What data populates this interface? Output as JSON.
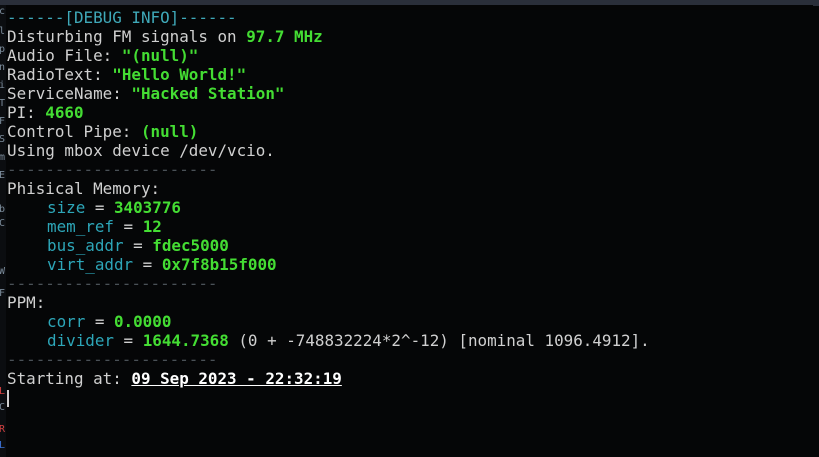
{
  "header": "------[DEBUG INFO]------",
  "line_disturbing": {
    "prefix": "Disturbing FM signals on ",
    "value": "97.7 MHz"
  },
  "line_audio": {
    "prefix": "Audio File: ",
    "value": "\"(null)\""
  },
  "line_radiotext": {
    "prefix": "RadioText: ",
    "value": "\"Hello World!\""
  },
  "line_servicename": {
    "prefix": "ServiceName: ",
    "value": "\"Hacked Station\""
  },
  "line_pi": {
    "prefix": "PI: ",
    "value": "4660"
  },
  "line_pipe": {
    "prefix": "Control Pipe: ",
    "value": "(null)"
  },
  "line_mbox": "Using mbox device /dev/vcio.",
  "separator": "----------------------",
  "memory": {
    "title": "Phisical Memory:",
    "rows": [
      {
        "key": "size",
        "eq": " = ",
        "value": "3403776"
      },
      {
        "key": "mem_ref",
        "eq": " = ",
        "value": "12"
      },
      {
        "key": "bus_addr",
        "eq": " = ",
        "value": "fdec5000"
      },
      {
        "key": "virt_addr",
        "eq": " = ",
        "value": "0x7f8b15f000"
      }
    ]
  },
  "ppm": {
    "title": "PPM:",
    "corr": {
      "key": "corr",
      "eq": " = ",
      "value": "0.0000"
    },
    "divider": {
      "key": "divider",
      "eq": " = ",
      "value": "1644.7368",
      "suffix": " (0 + -748832224*2^-12) [nominal 1096.4912]."
    }
  },
  "starting": {
    "prefix": "Starting at: ",
    "value": "09 Sep 2023 - 22:32:19"
  },
  "left_edge_glyphs": [
    "c",
    "l",
    "p",
    "n",
    "i",
    "T",
    "F",
    "S",
    "m",
    "E",
    "b",
    "C",
    "W",
    "F",
    "L",
    "C",
    "R",
    "L"
  ],
  "colors": {
    "label_cyan": "#2da6b8",
    "value_green": "#44dd33",
    "background": "#050607"
  }
}
